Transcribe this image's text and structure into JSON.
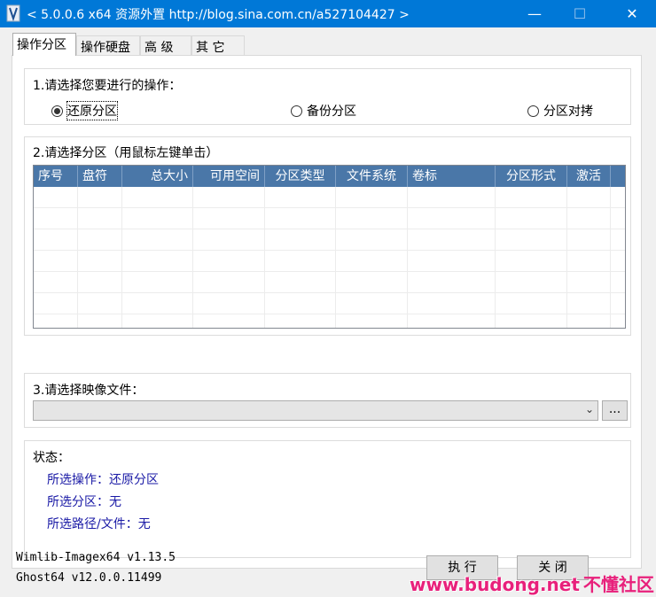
{
  "window": {
    "title": "< 5.0.0.6 x64 资源外置 http://blog.sina.com.cn/a527104427 >",
    "minimize_glyph": "—",
    "maximize_glyph": "☐",
    "close_glyph": "✕"
  },
  "tabs": [
    {
      "label": "操作分区",
      "active": true
    },
    {
      "label": "操作硬盘",
      "active": false
    },
    {
      "label": "高 级",
      "active": false
    },
    {
      "label": "其 它",
      "active": false
    }
  ],
  "operation": {
    "title": "1.请选择您要进行的操作：",
    "options": [
      {
        "label": "还原分区",
        "selected": true
      },
      {
        "label": "备份分区",
        "selected": false
      },
      {
        "label": "分区对拷",
        "selected": false
      }
    ]
  },
  "partition": {
    "title": "2.请选择分区（用鼠标左键单击）",
    "columns": [
      "序号",
      "盘符",
      "总大小",
      "可用空间",
      "分区类型",
      "文件系统",
      "卷标",
      "分区形式",
      "激活"
    ],
    "rows": []
  },
  "image_file": {
    "title": "3.请选择映像文件：",
    "value": "",
    "browse_label": "..."
  },
  "status": {
    "title": "状态：",
    "operation_line": "所选操作：还原分区",
    "partition_line": "所选分区：无",
    "path_line": "所选路径/文件：无"
  },
  "footer": {
    "wimlib_version": "Wimlib-Imagex64 v1.13.5",
    "ghost_version": "Ghost64 v12.0.0.11499",
    "execute_label": "执 行",
    "close_label": "关 闭",
    "watermark_url": "www.budong.net",
    "watermark_cn": "不懂社区"
  },
  "colors": {
    "titlebar": "#0078d7",
    "table_header": "#4a77a8",
    "status_text": "#1a1aa6",
    "watermark": "#e8207b"
  }
}
